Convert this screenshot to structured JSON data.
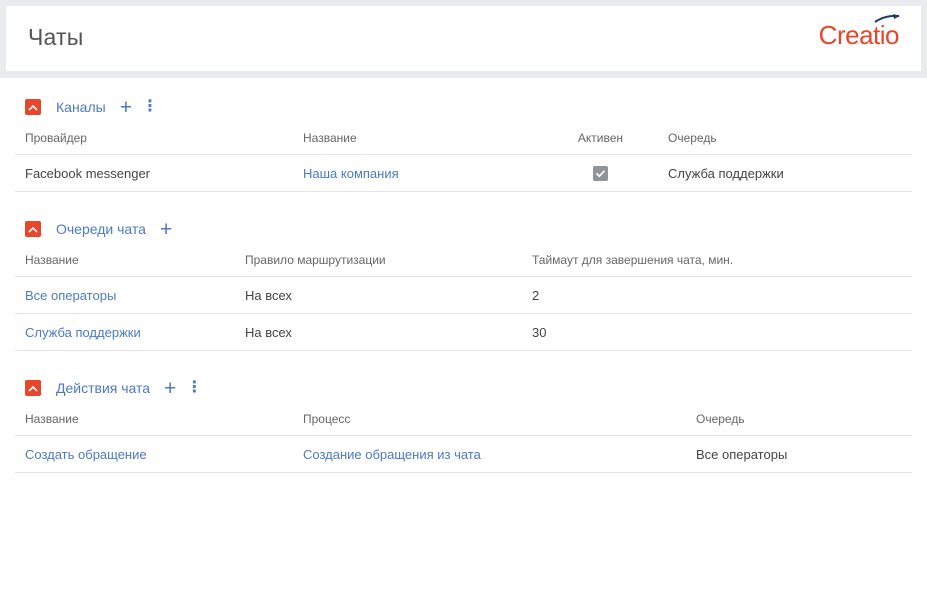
{
  "header": {
    "title": "Чаты",
    "logo_text": "Creatio"
  },
  "colors": {
    "accent": "#e8452a",
    "link": "#4b7ac7"
  },
  "channels": {
    "title": "Каналы",
    "columns": [
      "Провайдер",
      "Название",
      "Активен",
      "Очередь"
    ],
    "rows": [
      {
        "provider": "Facebook messenger",
        "name": "Наша компания",
        "active": true,
        "queue": "Служба поддержки"
      }
    ]
  },
  "queues": {
    "title": "Очереди чата",
    "columns": [
      "Название",
      "Правило маршрутизации",
      "Таймаут для завершения чата, мин."
    ],
    "rows": [
      {
        "name": "Все операторы",
        "rule": "На всех",
        "timeout": "2"
      },
      {
        "name": "Служба поддержки",
        "rule": "На всех",
        "timeout": "30"
      }
    ]
  },
  "actions": {
    "title": "Действия чата",
    "columns": [
      "Название",
      "Процесс",
      "Очередь"
    ],
    "rows": [
      {
        "name": "Создать обращение",
        "process": "Создание обращения из чата",
        "queue": "Все операторы"
      }
    ]
  }
}
